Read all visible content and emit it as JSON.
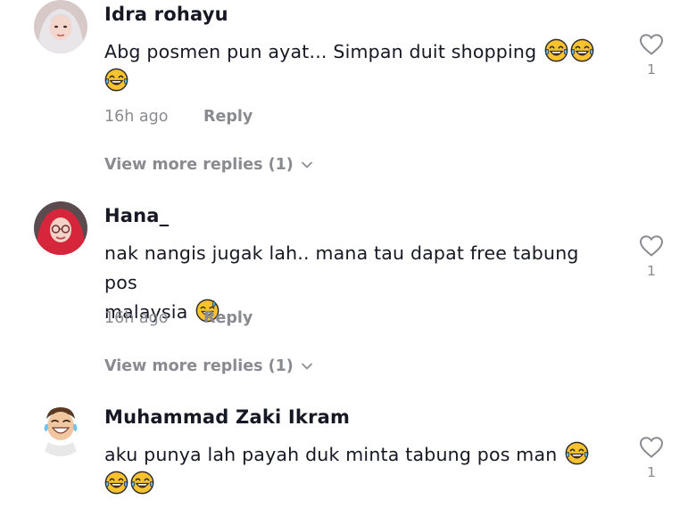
{
  "comments": [
    {
      "username": "Idra rohayu",
      "text_line1": "Abg posmen pun ayat... Simpan duit shopping",
      "time": "16h ago",
      "reply_label": "Reply",
      "view_replies": "View more replies (1)",
      "likes": "1",
      "avatar": "woman-hijab-avatar",
      "emojis": [
        "face-with-tears-of-joy",
        "face-with-tears-of-joy",
        "face-with-tears-of-joy"
      ]
    },
    {
      "username": "Hana_",
      "text_line1": "nak nangis jugak lah.. mana tau dapat free tabung pos",
      "text_line2": "malaysia",
      "time": "16h ago",
      "reply_label": "Reply",
      "view_replies": "View more replies (1)",
      "likes": "1",
      "avatar": "woman-red-hijab-glasses-avatar",
      "emojis": [
        "grinning-face-with-sweat"
      ]
    },
    {
      "username": "Muhammad Zaki Ikram",
      "text_line1": "aku punya lah payah duk minta tabung pos man",
      "likes": "1",
      "avatar": "memoji-man-laughing-avatar",
      "emojis": [
        "face-with-tears-of-joy",
        "face-with-tears-of-joy",
        "face-with-tears-of-joy"
      ]
    }
  ],
  "icons": {
    "like": "heart-outline-icon",
    "expand": "chevron-down-icon"
  },
  "colors": {
    "text_primary": "#161823",
    "text_secondary": "#8a8b91",
    "emoji_yellow": "#f7b500"
  }
}
